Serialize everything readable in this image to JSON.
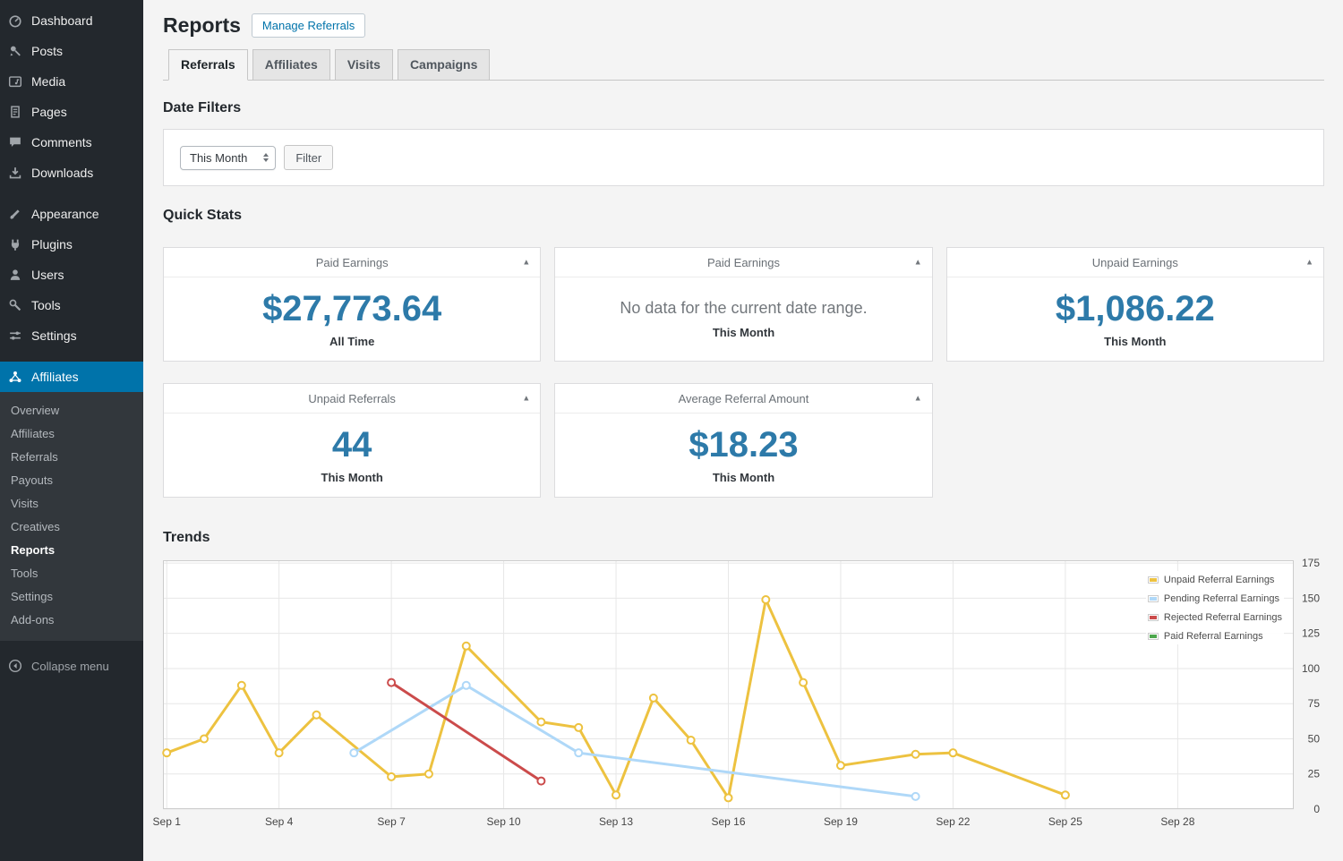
{
  "sidebar": {
    "items": [
      "Dashboard",
      "Posts",
      "Media",
      "Pages",
      "Comments",
      "Downloads",
      "Appearance",
      "Plugins",
      "Users",
      "Tools",
      "Settings",
      "Affiliates"
    ],
    "submenu": [
      "Overview",
      "Affiliates",
      "Referrals",
      "Payouts",
      "Visits",
      "Creatives",
      "Reports",
      "Tools",
      "Settings",
      "Add-ons"
    ],
    "collapse_label": "Collapse menu"
  },
  "page": {
    "title": "Reports",
    "action": "Manage Referrals"
  },
  "tabs": [
    "Referrals",
    "Affiliates",
    "Visits",
    "Campaigns"
  ],
  "filters": {
    "heading": "Date Filters",
    "range_value": "This Month",
    "submit": "Filter"
  },
  "stats": {
    "heading": "Quick Stats",
    "cards": [
      {
        "title": "Paid Earnings",
        "value": "$27,773.64",
        "caption": "All Time"
      },
      {
        "title": "Paid Earnings",
        "message": "No data for the current date range.",
        "caption": "This Month"
      },
      {
        "title": "Unpaid Earnings",
        "value": "$1,086.22",
        "caption": "This Month"
      },
      {
        "title": "Unpaid Referrals",
        "value": "44",
        "caption": "This Month"
      },
      {
        "title": "Average Referral Amount",
        "value": "$18.23",
        "caption": "This Month"
      }
    ]
  },
  "trends": {
    "heading": "Trends"
  },
  "chart_data": {
    "type": "line",
    "title": "Trends",
    "x_domain": [
      0.9,
      31.1
    ],
    "y_domain": [
      0,
      177
    ],
    "yticks": [
      0,
      25,
      50,
      75,
      100,
      125,
      150,
      175
    ],
    "xticks": [
      [
        1,
        "Sep 1"
      ],
      [
        4,
        "Sep 4"
      ],
      [
        7,
        "Sep 7"
      ],
      [
        10,
        "Sep 10"
      ],
      [
        13,
        "Sep 13"
      ],
      [
        16,
        "Sep 16"
      ],
      [
        19,
        "Sep 19"
      ],
      [
        22,
        "Sep 22"
      ],
      [
        25,
        "Sep 25"
      ],
      [
        28,
        "Sep 28"
      ]
    ],
    "grid": true,
    "legend_position": "top-right",
    "series": [
      {
        "name": "Unpaid Referral Earnings",
        "color": "#edc240",
        "points": [
          [
            1,
            40
          ],
          [
            2,
            50
          ],
          [
            3,
            88
          ],
          [
            4,
            40
          ],
          [
            5,
            67
          ],
          [
            7,
            23
          ],
          [
            8,
            25
          ],
          [
            9,
            116
          ],
          [
            11,
            62
          ],
          [
            12,
            58
          ],
          [
            13,
            10
          ],
          [
            14,
            79
          ],
          [
            15,
            49
          ],
          [
            16,
            8
          ],
          [
            17,
            149
          ],
          [
            18,
            90
          ],
          [
            19,
            31
          ],
          [
            21,
            39
          ],
          [
            22,
            40
          ],
          [
            25,
            10
          ]
        ]
      },
      {
        "name": "Pending Referral Earnings",
        "color": "#afd8f8",
        "points": [
          [
            6,
            40
          ],
          [
            9,
            88
          ],
          [
            12,
            40
          ],
          [
            21,
            9
          ]
        ]
      },
      {
        "name": "Rejected Referral Earnings",
        "color": "#cb4b4b",
        "points": [
          [
            7,
            90
          ],
          [
            11,
            20
          ]
        ]
      },
      {
        "name": "Paid Referral Earnings",
        "color": "#4da74d",
        "points": []
      }
    ]
  },
  "colors": {
    "accent": "#0073aa",
    "sidebar_bg": "#23282d",
    "submenu_bg": "#32373c",
    "stat_value": "#2d7aa9",
    "grid_line": "#e7e7e7",
    "chart_border": "#cccccc"
  }
}
